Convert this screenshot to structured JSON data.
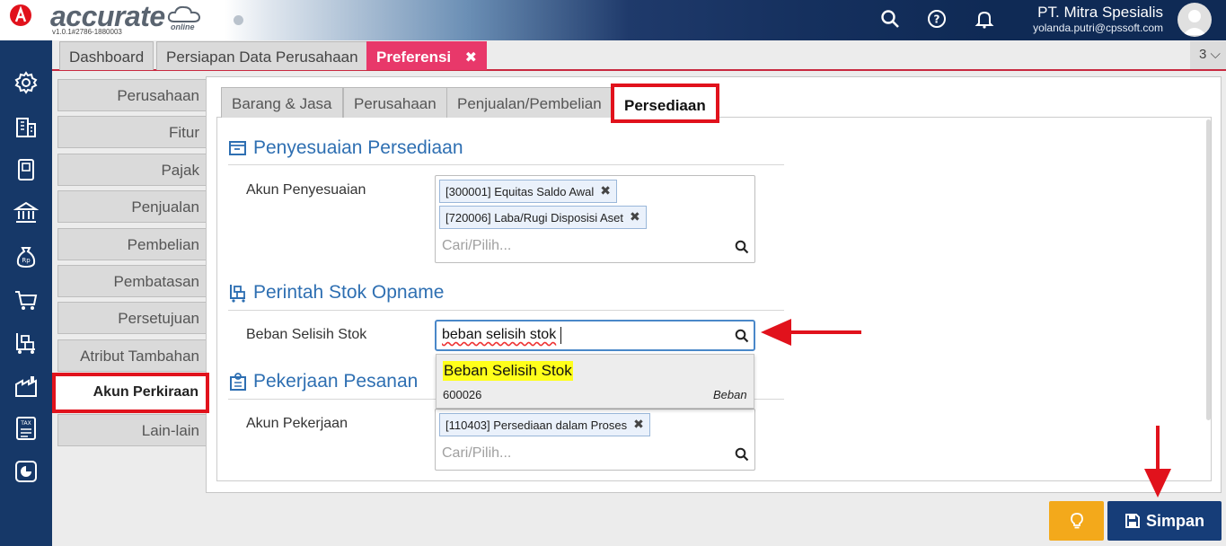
{
  "header": {
    "logo_text": "accurate",
    "logo_suffix": "online",
    "version": "v1.0.1#2786-1880003",
    "company": "PT. Mitra Spesialis",
    "email": "yolanda.putri@cpssoft.com"
  },
  "top_tabs": [
    {
      "label": "Dashboard"
    },
    {
      "label": "Persiapan Data Perusahaan"
    },
    {
      "label": "Preferensi",
      "close": "✖"
    }
  ],
  "tab_counter": "3 ⌵",
  "sidebar": {
    "items": [
      {
        "label": "Perusahaan"
      },
      {
        "label": "Fitur"
      },
      {
        "label": "Pajak"
      },
      {
        "label": "Penjualan"
      },
      {
        "label": "Pembelian"
      },
      {
        "label": "Pembatasan"
      },
      {
        "label": "Persetujuan"
      },
      {
        "label": "Atribut Tambahan"
      },
      {
        "label": "Akun Perkiraan"
      },
      {
        "label": "Lain-lain"
      }
    ]
  },
  "sub_tabs": [
    {
      "label": "Barang & Jasa"
    },
    {
      "label": "Perusahaan"
    },
    {
      "label": "Penjualan/Pembelian"
    },
    {
      "label": "Persediaan"
    }
  ],
  "sections": {
    "penyesuaian": {
      "title": "Penyesuaian Persediaan",
      "field_label": "Akun Penyesuaian",
      "chips": [
        "[300001] Equitas Saldo Awal",
        "[720006] Laba/Rugi Disposisi Aset"
      ],
      "placeholder": "Cari/Pilih..."
    },
    "opname": {
      "title": "Perintah Stok Opname",
      "field_label": "Beban Selisih Stok",
      "search_value": "beban selisih stok",
      "dropdown": {
        "name": "Beban Selisih Stok",
        "code": "600026",
        "type": "Beban"
      }
    },
    "pesanan": {
      "title": "Pekerjaan Pesanan",
      "field_label": "Akun Pekerjaan",
      "chips": [
        "[110403] Persediaan dalam Proses"
      ],
      "placeholder": "Cari/Pilih..."
    }
  },
  "buttons": {
    "save_label": "Simpan"
  },
  "chip_close": "✖",
  "colors": {
    "accent": "#e8386a",
    "nav": "#163868",
    "heading": "#2e6fb2",
    "highlight": "#e1121c",
    "save": "#163d78",
    "tip": "#f3a91b"
  }
}
